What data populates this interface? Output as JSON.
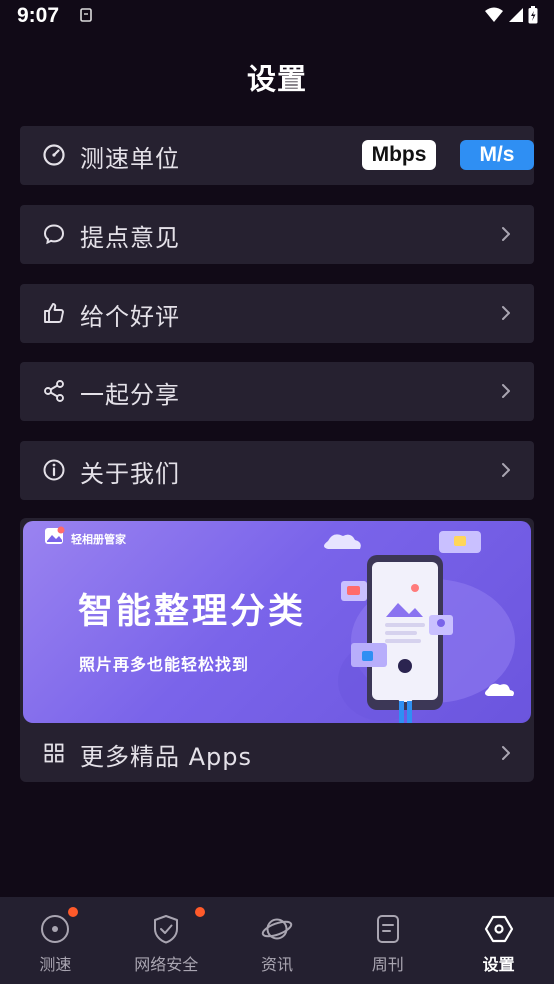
{
  "status_bar": {
    "time": "9:07"
  },
  "page": {
    "title": "设置"
  },
  "settings": {
    "speed_unit": {
      "label": "测速单位",
      "options": [
        "Mbps",
        "M/s"
      ],
      "selected": "M/s"
    },
    "feedback": {
      "label": "提点意见"
    },
    "rate": {
      "label": "给个好评"
    },
    "share": {
      "label": "一起分享"
    },
    "about": {
      "label": "关于我们"
    }
  },
  "promo": {
    "brand": "轻相册管家",
    "headline": "智能整理分类",
    "subline": "照片再多也能轻松找到",
    "more_apps_label": "更多精品 Apps"
  },
  "tabbar": {
    "tabs": [
      {
        "label": "测速",
        "icon": "speedometer-icon",
        "badge": true
      },
      {
        "label": "网络安全",
        "icon": "shield-check-icon",
        "badge": true
      },
      {
        "label": "资讯",
        "icon": "planet-icon",
        "badge": false
      },
      {
        "label": "周刊",
        "icon": "document-icon",
        "badge": false
      },
      {
        "label": "设置",
        "icon": "hexagon-settings-icon",
        "badge": false
      }
    ],
    "active": "设置"
  },
  "colors": {
    "background": "#110a17",
    "row_background": "#262130",
    "accent_blue": "#2f8ff3",
    "badge_orange": "#ff5a2a",
    "banner_purple": "#7a64ea"
  }
}
